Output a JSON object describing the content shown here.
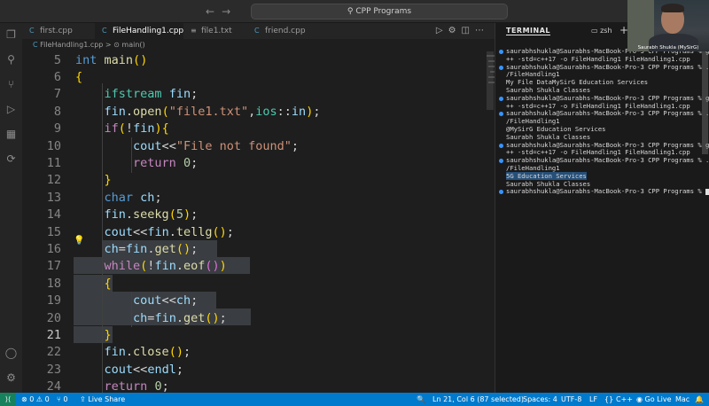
{
  "window": {
    "title": "CPP Programs",
    "search_icon": "search-icon"
  },
  "tabs": [
    {
      "label": "first.cpp",
      "icon": "cpp-file-icon",
      "active": false
    },
    {
      "label": "FileHandling1.cpp",
      "icon": "cpp-file-icon",
      "active": true
    },
    {
      "label": "file1.txt",
      "icon": "text-file-icon",
      "active": false
    },
    {
      "label": "friend.cpp",
      "icon": "cpp-file-icon",
      "active": false
    }
  ],
  "breadcrumb": {
    "file": "FileHandling1.cpp",
    "separator": ">",
    "symbol": "main()"
  },
  "editor": {
    "language": "C++",
    "current_line": 21,
    "lines": [
      {
        "n": "5",
        "text": "int main()"
      },
      {
        "n": "6",
        "text": "{"
      },
      {
        "n": "7",
        "text": "    ifstream fin;"
      },
      {
        "n": "8",
        "text": "    fin.open(\"file1.txt\",ios::in);"
      },
      {
        "n": "9",
        "text": "    if(!fin){"
      },
      {
        "n": "10",
        "text": "        cout<<\"File not found\";"
      },
      {
        "n": "11",
        "text": "        return 0;"
      },
      {
        "n": "12",
        "text": "    }"
      },
      {
        "n": "13",
        "text": "    char ch;"
      },
      {
        "n": "14",
        "text": "    fin.seekg(5);"
      },
      {
        "n": "15",
        "text": "    cout<<fin.tellg();"
      },
      {
        "n": "16",
        "text": "    ch=fin.get();"
      },
      {
        "n": "17",
        "text": "    while(!fin.eof())"
      },
      {
        "n": "18",
        "text": "    {"
      },
      {
        "n": "19",
        "text": "        cout<<ch;"
      },
      {
        "n": "20",
        "text": "        ch=fin.get();"
      },
      {
        "n": "21",
        "text": "    }"
      },
      {
        "n": "22",
        "text": "    fin.close();"
      },
      {
        "n": "23",
        "text": "    cout<<endl;"
      },
      {
        "n": "24",
        "text": "    return 0;"
      }
    ]
  },
  "terminal": {
    "tab_label": "TERMINAL",
    "shell_label": "zsh",
    "add_label": "+",
    "lines": [
      "saurabhshukla@Saurabhs-MacBook-Pro-3 CPP Programs % g",
      "++ -std=c++17 -o FileHandling1 FileHandling1.cpp",
      "saurabhshukla@Saurabhs-MacBook-Pro-3 CPP Programs % .",
      "/FileHandling1",
      "My File DataMySirG Education Services",
      "Saurabh Shukla Classes",
      "saurabhshukla@Saurabhs-MacBook-Pro-3 CPP Programs % g",
      "++ -std=c++17 -o FileHandling1 FileHandling1.cpp",
      "saurabhshukla@Saurabhs-MacBook-Pro-3 CPP Programs % .",
      "/FileHandling1",
      "@MySirG Education Services",
      "Saurabh Shukla Classes",
      "saurabhshukla@Saurabhs-MacBook-Pro-3 CPP Programs % g",
      "++ -std=c++17 -o FileHandling1 FileHandling1.cpp",
      "saurabhshukla@Saurabhs-MacBook-Pro-3 CPP Programs % .",
      "/FileHandling1",
      "5G Education Services",
      "Saurabh Shukla Classes",
      "saurabhshukla@Saurabhs-MacBook-Pro-3 CPP Programs % "
    ]
  },
  "webcam": {
    "caption": "Saurabh Shukla (MySirG)"
  },
  "statusbar": {
    "remote": "⟩⟨",
    "problems": "⊗ 0 ⚠ 0",
    "ports": "⑂ 0",
    "live_share": "Live Share",
    "zoom": "🔍",
    "cursor": "Ln 21, Col 6 (87 selected)",
    "spaces": "Spaces: 4",
    "encoding": "UTF-8",
    "eol": "LF",
    "lang_braces": "{}",
    "language": "C++",
    "go_live": "Go Live",
    "platform": "Mac",
    "bell": "🔔"
  }
}
